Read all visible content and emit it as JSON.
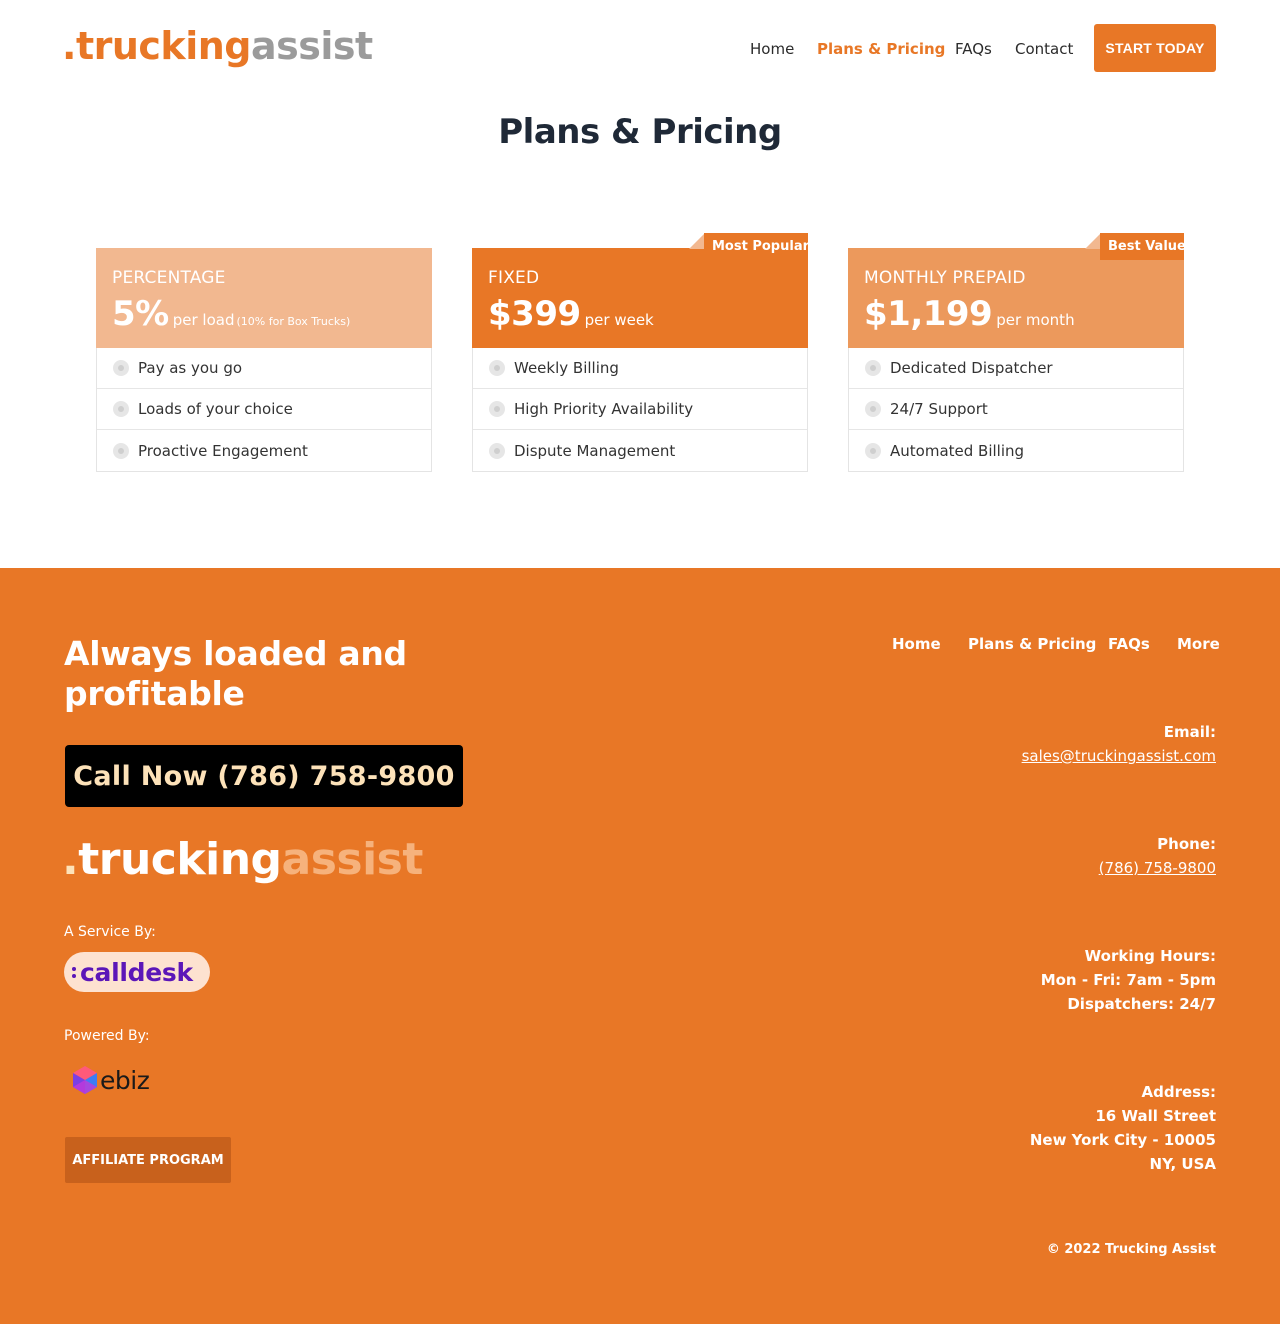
{
  "header": {
    "logo": {
      "dot": ".",
      "part1": "trucking",
      "part2": "assist"
    },
    "nav": [
      {
        "label": "Home",
        "active": false
      },
      {
        "label": "Plans & Pricing",
        "active": true
      },
      {
        "label": "FAQs",
        "active": false
      },
      {
        "label": "Contact",
        "active": false
      }
    ],
    "cta": "START TODAY"
  },
  "main": {
    "title": "Plans & Pricing",
    "plans": [
      {
        "name": "PERCENTAGE",
        "price": "5%",
        "per": "per load",
        "note": "(10% for Box Trucks)",
        "ribbon": "",
        "head_color": "#f2b890",
        "features": [
          "Pay as you go",
          "Loads of your choice",
          "Proactive Engagement"
        ]
      },
      {
        "name": "FIXED",
        "price": "$399",
        "per": "per week",
        "note": "",
        "ribbon": "Most Popular",
        "head_color": "#e87726",
        "features": [
          "Weekly Billing",
          "High Priority Availability",
          "Dispute Management"
        ]
      },
      {
        "name": "MONTHLY PREPAID",
        "price": "$1,199",
        "per": "per month",
        "note": "",
        "ribbon": "Best Value",
        "head_color": "#ec995c",
        "features": [
          "Dedicated Dispatcher",
          "24/7 Support",
          "Automated Billing"
        ]
      }
    ]
  },
  "footer": {
    "tagline": "Always loaded and profitable",
    "call_button": "Call Now (786) 758-9800",
    "logo": {
      "dot": ".",
      "part1": "trucking",
      "part2": "assist"
    },
    "service_by_label": "A Service By:",
    "calldesk_logo": "calldesk",
    "powered_by_label": "Powered By:",
    "ebiz_logo": "ebiz",
    "affiliate_button": "AFFILIATE PROGRAM",
    "nav": [
      "Home",
      "Plans & Pricing",
      "FAQs",
      "More"
    ],
    "email_label": "Email:",
    "email": "sales@truckingassist.com",
    "phone_label": "Phone:",
    "phone": "(786) 758-9800",
    "hours_label": "Working Hours:",
    "hours_line1": "Mon - Fri: 7am - 5pm",
    "hours_line2": "Dispatchers: 24/7",
    "address_label": "Address:",
    "address_line1": "16 Wall Street",
    "address_line2": "New York City - 10005",
    "address_line3": "NY, USA",
    "copyright": "© 2022 Trucking Assist"
  },
  "colors": {
    "brand_orange": "#e87726",
    "logo_gray": "#9b9b9b",
    "calldesk_purple": "#5b16b8"
  },
  "icons": {
    "feature_bullet": "radio-dot-icon",
    "ebiz_mark": "ebiz-cube-icon"
  }
}
